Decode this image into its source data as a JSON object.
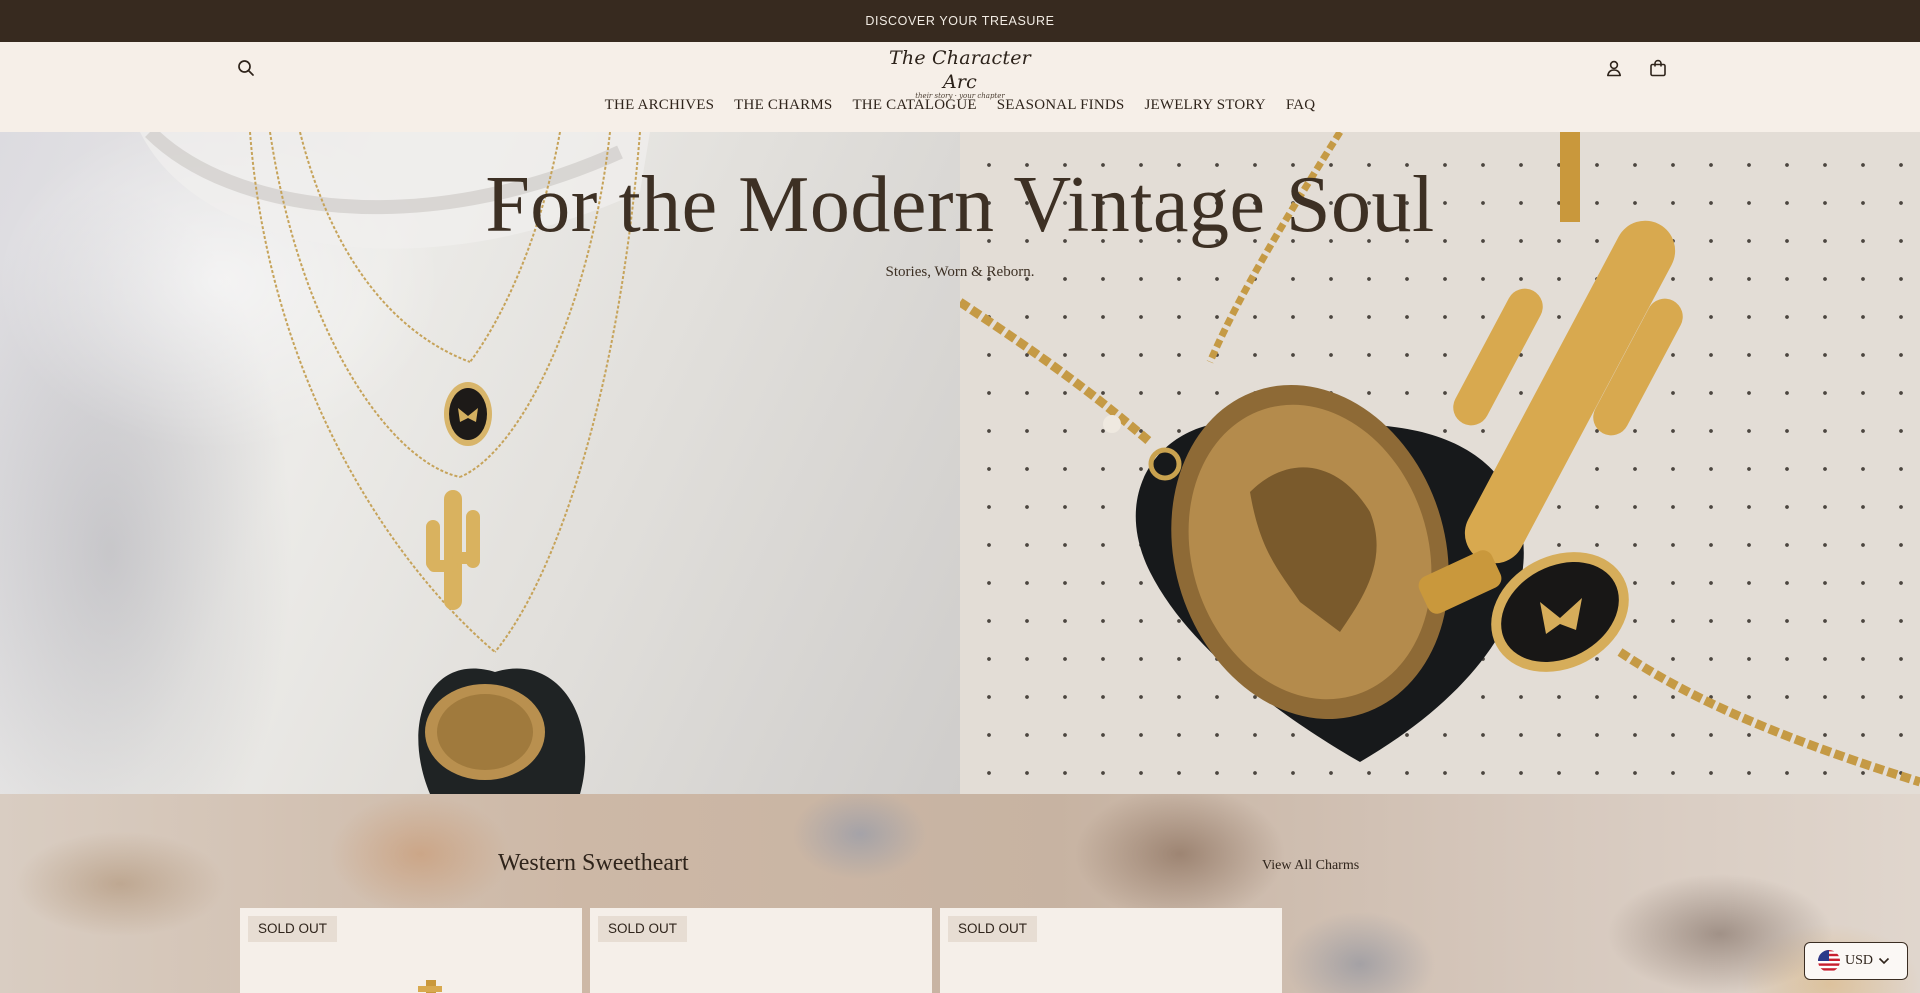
{
  "announcement": {
    "text": "DISCOVER YOUR TREASURE"
  },
  "header": {
    "logo_title": "The Character Arc",
    "logo_tagline": "their story · your chapter",
    "icons": {
      "search": "search-icon",
      "account": "user-icon",
      "cart": "shopping-bag-icon"
    }
  },
  "nav": {
    "items": [
      {
        "label": "THE ARCHIVES"
      },
      {
        "label": "THE CHARMS"
      },
      {
        "label": "THE CATALOGUE"
      },
      {
        "label": "SEASONAL FINDS"
      },
      {
        "label": "JEWELRY STORY"
      },
      {
        "label": "FAQ"
      }
    ]
  },
  "hero": {
    "title": "For the Modern Vintage Soul",
    "subtitle": "Stories, Worn & Reborn."
  },
  "collection": {
    "title": "Western Sweetheart",
    "view_all": "View All Charms",
    "cards": [
      {
        "badge": "SOLD OUT"
      },
      {
        "badge": "SOLD OUT"
      },
      {
        "badge": "SOLD OUT"
      }
    ]
  },
  "currency": {
    "label": "USD",
    "flag_icon": "us-flag-icon",
    "chevron_icon": "chevron-down-icon"
  },
  "colors": {
    "announcement_bg": "#372a1f",
    "page_bg": "#f5eee7",
    "text_dark": "#3a2d22",
    "gold": "#c9a24f"
  }
}
